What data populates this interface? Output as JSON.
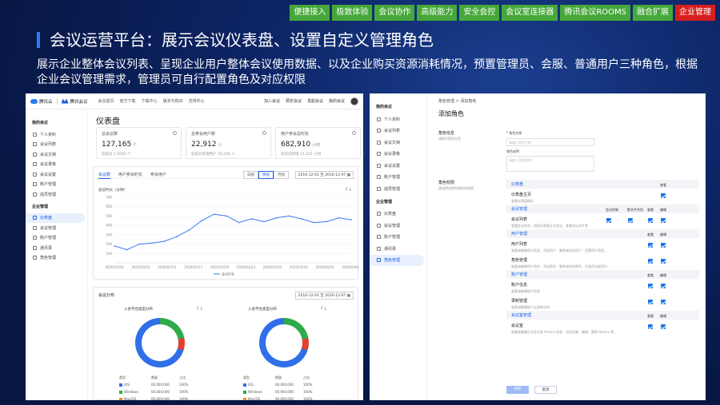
{
  "topnav": [
    "便捷接入",
    "极致体验",
    "会议协作",
    "高级能力",
    "安全会控",
    "会议室连接器",
    "腾讯会议ROOMS",
    "融合扩展",
    "企业管理"
  ],
  "topnav_active": 8,
  "slide": {
    "title": "会议运营平台：展示会议仪表盘、设置自定义管理角色",
    "desc": "展示企业整体会议列表、呈现企业用户整体会议使用数据、以及企业购买资源消耗情况，预置管理员、会服、普通用户三种角色，根据企业会议管理需求，管理员可自行配置角色及对应权限"
  },
  "p1": {
    "brand1": "腾讯云",
    "brand2": "腾讯会议",
    "nav": [
      "会议首页",
      "官方下载",
      "下载中心",
      "版本与购买",
      "支持中心"
    ],
    "right": [
      "加入会议",
      "预定会议",
      "发起会议",
      "我的会议"
    ],
    "side_group1": "我的会议",
    "side1": [
      "个人资料",
      "会议列表",
      "会议文档",
      "会议录像",
      "会议设置",
      "账户管理",
      "成员管理"
    ],
    "side_group2": "企业管理",
    "side2": [
      "仪表盘",
      "会议管理",
      "账户管理",
      "通讯录",
      "角色管理"
    ],
    "selected": "仪表盘",
    "page_title": "仪表盘",
    "cards": [
      {
        "label": "总会议数",
        "value": "127,165",
        "unit": "个",
        "sub": "较前日 2,0000 个"
      },
      {
        "label": "总参会用户数",
        "value": "22,912",
        "unit": "人",
        "sub": "较前日新增用户 10,256 人"
      },
      {
        "label": "用户参会总时长",
        "value": "682,910",
        "unit": "小时",
        "sub": "较前日新增 12,221 小时"
      }
    ],
    "tabs": [
      "会议数",
      "用户参会时长",
      "参会用户"
    ],
    "segments": [
      "日视",
      "周视",
      "月视"
    ],
    "date_range": "2016-12-01 至 2016-12-07",
    "chart_label": "会议时长（分钟）",
    "dist_title": "会议分布",
    "donuts": [
      {
        "title": "入会平台类型分布"
      },
      {
        "title": "入会平台类型分布"
      }
    ],
    "legend_header": [
      "类型",
      "数量",
      "占比"
    ],
    "legend_rows": [
      {
        "name": "iOS",
        "count": "00,000,000",
        "pct": "100%",
        "color": "#2f6fe8"
      },
      {
        "name": "Windows",
        "count": "00,000,000",
        "pct": "100%",
        "color": "#2faa4a"
      },
      {
        "name": "Mac/OS",
        "count": "00,000,000",
        "pct": "100%",
        "color": "#f08a24"
      },
      {
        "name": "Android",
        "count": "00,000,000",
        "pct": "100%",
        "color": "#e0402f"
      }
    ]
  },
  "chart_data": {
    "type": "line",
    "title": "会议时长（分钟）",
    "x": [
      "2020/03/06",
      "2020/03/10",
      "2020/03/14",
      "2020/03/17",
      "2020/03/20",
      "2020/03/23",
      "2020/03/28",
      "2020/03/30",
      "2020/04/01",
      "2020/04/04"
    ],
    "ylim": [
      0,
      700
    ],
    "yticks": [
      100,
      200,
      300,
      400,
      500,
      600,
      700
    ],
    "series": [
      {
        "name": "会议时长",
        "values": [
          180,
          140,
          200,
          210,
          230,
          280,
          350,
          450,
          520,
          500,
          430,
          470,
          440,
          480,
          500,
          470,
          430,
          440,
          480,
          460
        ]
      }
    ],
    "legend": "bottom",
    "grid": true
  },
  "p2": {
    "side_group1": "我的会议",
    "side1": [
      "个人资料",
      "会议列表",
      "会议文档",
      "会议录像",
      "会议设置",
      "账户管理",
      "成员管理"
    ],
    "side_group2": "企业管理",
    "side2": [
      "仪表盘",
      "会议管理",
      "账户管理",
      "通讯录",
      "角色管理"
    ],
    "selected": "角色管理",
    "breadcrumb": "角色管理 > 添加角色",
    "heading": "添加角色",
    "role_info": "角色信息",
    "role_info_sub": "请填写角色信息",
    "name_label": "* 角色名称",
    "name_ph": "请输入角色名称",
    "desc_label": "角色说明",
    "desc_ph": "请输入角色说明",
    "perm_label": "角色权限",
    "perm_sub": "请选择该角色拥有的权限",
    "sections": [
      {
        "title": "仪表盘",
        "cols": [
          "查看"
        ],
        "items": [
          {
            "name": "仪表盘主页",
            "desc": "查看仪表盘概况"
          }
        ]
      },
      {
        "title": "会议管理",
        "cols": [
          "会议控制",
          "数文件共用",
          "查看",
          "编辑"
        ],
        "items": [
          {
            "name": "会议列表",
            "desc": "查看会议信息、创建及管理企业会议、查看会议文件等"
          }
        ]
      },
      {
        "title": "用户管理",
        "cols": [
          "查看",
          "编辑"
        ],
        "items": [
          {
            "name": "用户列表",
            "desc": "查看或编辑用户信息、添加用户、删除或冻结用户、设置用户角色。"
          },
          {
            "name": "角色管理",
            "desc": "查看或编辑用户角色、添加角色、删除或修改角色、为角色分配用户。"
          }
        ]
      },
      {
        "title": "账户管理",
        "cols": [
          "查看",
          "编辑"
        ],
        "items": [
          {
            "name": "账户信息",
            "desc": "查看或编辑账户信息"
          },
          {
            "name": "录制管理",
            "desc": "查看或编辑账户云录制空间"
          }
        ]
      },
      {
        "title": "会议室管理",
        "cols": [
          "查看",
          "编辑"
        ],
        "items": [
          {
            "name": "会议室",
            "desc": "查看或编辑企业会议室 Rooms 信息、添加设备、编辑、删除 Rooms 等。"
          }
        ]
      }
    ],
    "save": "保存",
    "cancel": "取消"
  },
  "colors": {
    "accent": "#2f7cf6",
    "nav_green": "#46a83a",
    "nav_red": "#d81e1e",
    "checkbox": "#1a73e8"
  }
}
